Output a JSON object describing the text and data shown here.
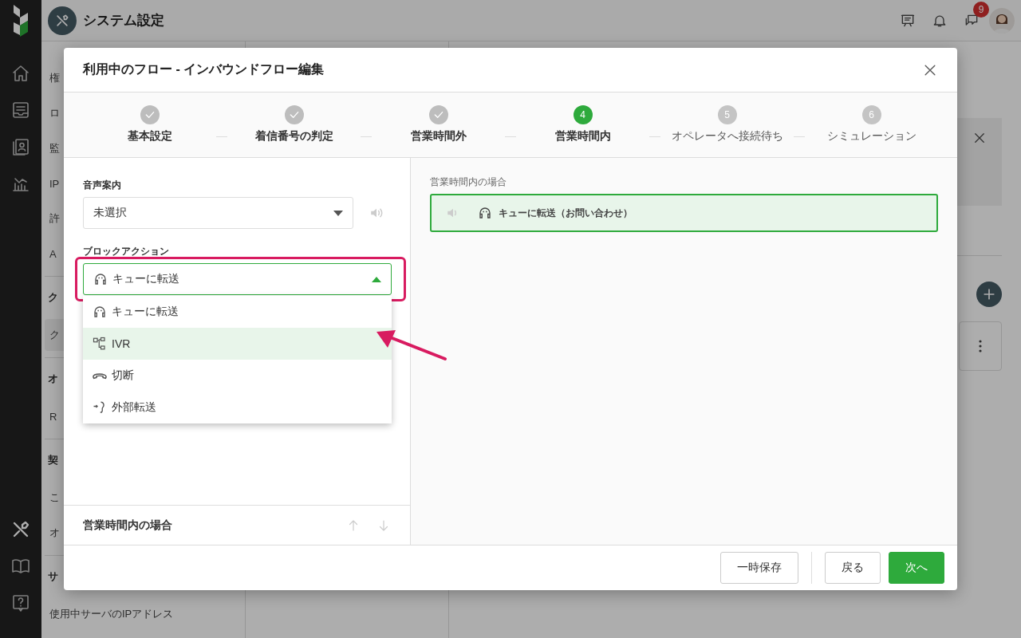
{
  "header": {
    "title": "システム設定",
    "notification_count": "9"
  },
  "rail": {
    "top": [
      {
        "kind": "home",
        "selected": false
      },
      {
        "kind": "inbox",
        "selected": false
      },
      {
        "kind": "contact",
        "selected": false
      },
      {
        "kind": "chart",
        "selected": false
      }
    ],
    "bottom": [
      {
        "kind": "tools",
        "selected": true
      },
      {
        "kind": "book",
        "selected": false
      },
      {
        "kind": "help",
        "selected": false
      }
    ]
  },
  "settings_nav": [
    {
      "kind": "item",
      "label": "権",
      "selected": false
    },
    {
      "kind": "item",
      "label": "ロ",
      "selected": false
    },
    {
      "kind": "item",
      "label": "監",
      "selected": false
    },
    {
      "kind": "item",
      "label": "IP",
      "selected": false
    },
    {
      "kind": "item",
      "label": "許",
      "selected": false
    },
    {
      "kind": "item",
      "label": "A",
      "selected": false
    },
    {
      "kind": "heading",
      "label": "ク"
    },
    {
      "kind": "item",
      "label": "ク",
      "selected": true
    },
    {
      "kind": "heading",
      "label": "オ"
    },
    {
      "kind": "item",
      "label": "R",
      "selected": false
    },
    {
      "kind": "heading",
      "label": "契"
    },
    {
      "kind": "item",
      "label": "こ",
      "selected": false
    },
    {
      "kind": "item",
      "label": "オ",
      "selected": false
    },
    {
      "kind": "heading",
      "label": "サ"
    },
    {
      "kind": "item",
      "label": "使用中サーバのIPアドレス",
      "selected": false
    }
  ],
  "dialog": {
    "title": "利用中のフロー - インバウンドフロー編集",
    "steps": [
      {
        "label": "基本設定",
        "done": true,
        "current": false
      },
      {
        "label": "着信番号の判定",
        "done": true,
        "current": false
      },
      {
        "label": "営業時間外",
        "done": true,
        "current": false
      },
      {
        "number": "4",
        "label": "営業時間内",
        "done": false,
        "current": true
      },
      {
        "number": "5",
        "label": "オペレータへ接続待ち",
        "done": false,
        "current": false
      },
      {
        "number": "6",
        "label": "シミュレーション",
        "done": false,
        "current": false
      }
    ],
    "voice_guide": {
      "label": "音声案内",
      "value": "未選択"
    },
    "block_action": {
      "label": "ブロックアクション",
      "value": {
        "kind": "queue",
        "label": "キューに転送"
      },
      "expanded": true,
      "options": [
        {
          "kind": "queue",
          "label": "キューに転送",
          "hovered": false
        },
        {
          "kind": "ivr",
          "label": "IVR",
          "hovered": true
        },
        {
          "kind": "hangup",
          "label": "切断",
          "hovered": false
        },
        {
          "kind": "external",
          "label": "外部転送",
          "hovered": false
        }
      ]
    },
    "block_list_title": "営業時間内の場合",
    "preview": {
      "label": "営業時間内の場合",
      "block": {
        "kind": "queue",
        "text": "キューに転送（お問い合わせ）",
        "selected": true
      }
    },
    "buttons": [
      {
        "kind": "secondary",
        "label": "一時保存"
      },
      {
        "kind": "divider"
      },
      {
        "kind": "secondary",
        "label": "戻る"
      },
      {
        "kind": "primary",
        "label": "次へ"
      }
    ]
  },
  "annotations": {
    "highlight_frame": true,
    "arrow": true
  }
}
